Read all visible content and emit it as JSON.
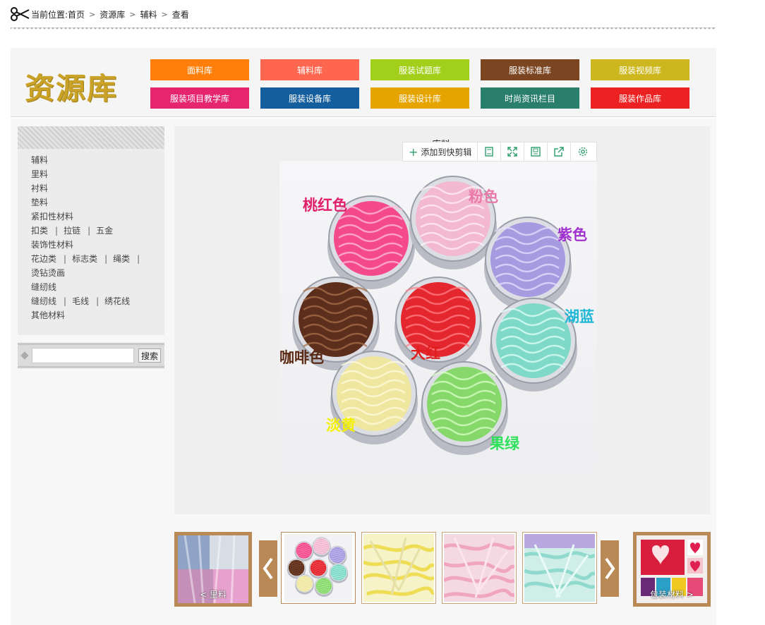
{
  "breadcrumb": {
    "prefix": "当前位置:",
    "items": [
      "首页",
      "资源库",
      "辅料",
      "查看"
    ]
  },
  "header": {
    "logo": "资源库",
    "nav": [
      {
        "label": "面料库",
        "color": "#ff7f0a"
      },
      {
        "label": "辅料库",
        "color": "#ff6650"
      },
      {
        "label": "服装试题库",
        "color": "#a2cf1a"
      },
      {
        "label": "服装标准库",
        "color": "#7a4520"
      },
      {
        "label": "服装视频库",
        "color": "#ccb71e"
      },
      {
        "label": "服装项目教学库",
        "color": "#e6256f"
      },
      {
        "label": "服装设备库",
        "color": "#155e9e"
      },
      {
        "label": "服装设计库",
        "color": "#e6a400"
      },
      {
        "label": "时尚资讯栏目",
        "color": "#2a7e6c"
      },
      {
        "label": "服装作品库",
        "color": "#ec2222"
      }
    ]
  },
  "sidebar": {
    "rows": [
      [
        "辅料"
      ],
      [
        "里料"
      ],
      [
        "衬料"
      ],
      [
        "垫料"
      ],
      [
        "紧扣性材料"
      ],
      [
        "扣类",
        "拉链",
        "五金"
      ],
      [
        "装饰性材料"
      ],
      [
        "花边类",
        "标志类",
        "绳类",
        ""
      ],
      [
        "烫钻烫画"
      ],
      [
        "缝纫线"
      ],
      [
        "缝纫线",
        "毛线",
        "绣花线"
      ],
      [
        "其他材料"
      ]
    ],
    "search": {
      "placeholder": "",
      "button": "搜索"
    }
  },
  "viewer": {
    "title": "库料",
    "toolbar": {
      "add_label": "添加到快剪辑"
    },
    "photo_labels": [
      {
        "text": "桃红色",
        "color": "#e0206a"
      },
      {
        "text": "粉色",
        "color": "#e97aa8"
      },
      {
        "text": "紫色",
        "color": "#a030d0"
      },
      {
        "text": "湖蓝",
        "color": "#1eb7d6"
      },
      {
        "text": "咖啡色",
        "color": "#5a2a14"
      },
      {
        "text": "大红",
        "color": "#e01e1e"
      },
      {
        "text": "淡黄",
        "color": "#f4f000"
      },
      {
        "text": "果绿",
        "color": "#2ee05a"
      }
    ]
  },
  "strip": {
    "prev_caption": "里料",
    "next_caption": "包装材料"
  }
}
